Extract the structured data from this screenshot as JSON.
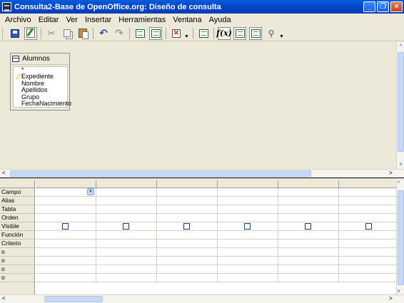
{
  "window": {
    "title": "Consulta2-Base de OpenOffice.org: Diseño de consulta",
    "minimize": "_",
    "maximize": "❐",
    "close": "×"
  },
  "menu": [
    {
      "label": "Archivo"
    },
    {
      "label": "Editar"
    },
    {
      "label": "Ver"
    },
    {
      "label": "Insertar"
    },
    {
      "label": "Herramientas"
    },
    {
      "label": "Ventana"
    },
    {
      "label": "Ayuda"
    }
  ],
  "toolbar": {
    "fx_label": "f(x)",
    "icons": [
      "save-icon",
      "edit-icon",
      "cut-icon",
      "copy-icon",
      "paste-icon",
      "undo-icon",
      "redo-icon",
      "run-query-icon",
      "clear-query-icon",
      "delete-icon",
      "add-table-icon",
      "functions-icon",
      "table-name-icon",
      "alias-icon",
      "distinct-values-icon"
    ]
  },
  "table_window": {
    "title": "Alumnos",
    "fields": [
      "*",
      "Expediente",
      "Nombre",
      "Apellidos",
      "Grupo",
      "FechaNacimiento"
    ],
    "primary_key": "Expediente"
  },
  "design_grid": {
    "row_labels": [
      "Campo",
      "Alias",
      "Tabla",
      "Orden",
      "Visible",
      "Función",
      "Criterio",
      "o",
      "o",
      "o",
      "o"
    ],
    "column_count": 6,
    "visible_checked": [
      false,
      false,
      false,
      false,
      false,
      false
    ]
  },
  "scroll_arrows": {
    "left": "<",
    "right": ">",
    "up": "^",
    "down": "v"
  }
}
